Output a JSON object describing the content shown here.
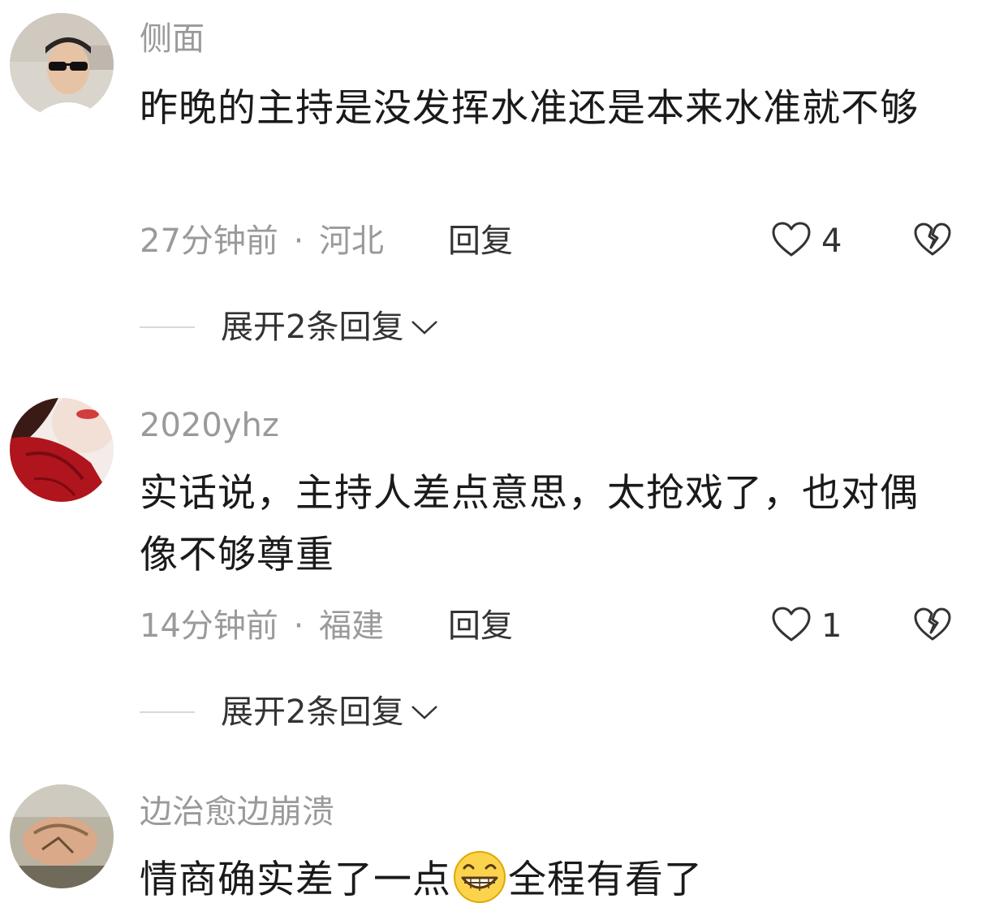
{
  "comments": [
    {
      "username": "侧面",
      "content": "昨晚的主持是没发挥水准还是本来水准就不够",
      "time": "27分钟前",
      "separator": "·",
      "location": "河北",
      "reply_label": "回复",
      "likes": "4",
      "expand_label": "展开2条回复"
    },
    {
      "username": "2020yhz",
      "content": "实话说，主持人差点意思，太抢戏了，也对偶像不够尊重",
      "time": "14分钟前",
      "separator": "·",
      "location": "福建",
      "reply_label": "回复",
      "likes": "1",
      "expand_label": "展开2条回复"
    },
    {
      "username": "边治愈边崩溃",
      "content_before_emoji": "情商确实差了一点",
      "emoji": "grinning-face-emoji",
      "content_after_emoji": "全程有看了"
    }
  ],
  "colors": {
    "text_primary": "#1a1a1a",
    "text_secondary": "#9a9a9a",
    "icon": "#333333"
  }
}
